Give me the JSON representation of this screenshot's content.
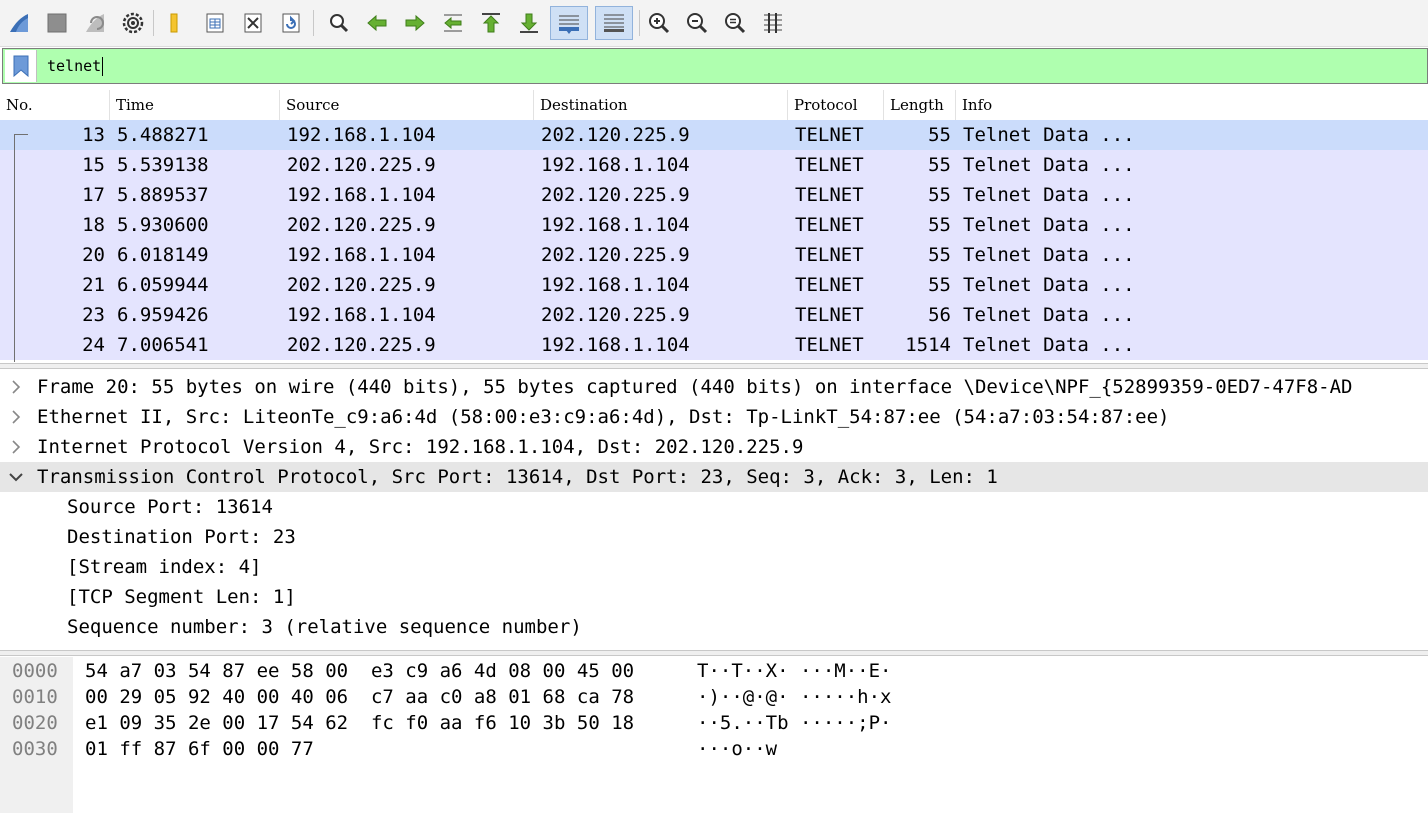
{
  "toolbar": {
    "buttons": [
      {
        "icon": "shark-fin-start-icon"
      },
      {
        "icon": "stop-square-icon"
      },
      {
        "icon": "restart-capture-icon"
      },
      {
        "icon": "capture-options-gear-icon"
      },
      {
        "icon": "open-folder-icon"
      },
      {
        "icon": "save-file-icon"
      },
      {
        "icon": "close-file-icon"
      },
      {
        "icon": "reload-file-icon"
      },
      {
        "icon": "find-packet-icon"
      },
      {
        "icon": "go-back-arrow-icon"
      },
      {
        "icon": "go-forward-arrow-icon"
      },
      {
        "icon": "go-to-packet-icon"
      },
      {
        "icon": "go-first-packet-icon"
      },
      {
        "icon": "go-last-packet-icon"
      },
      {
        "icon": "auto-scroll-icon",
        "active": true
      },
      {
        "icon": "colorize-icon",
        "active": true
      },
      {
        "icon": "zoom-in-icon"
      },
      {
        "icon": "zoom-out-icon"
      },
      {
        "icon": "normal-size-icon"
      },
      {
        "icon": "resize-columns-icon"
      }
    ]
  },
  "filter": {
    "value": "telnet",
    "background": "#afffaf"
  },
  "packet_list": {
    "columns": [
      "No.",
      "Time",
      "Source",
      "Destination",
      "Protocol",
      "Length",
      "Info"
    ],
    "rows": [
      {
        "no": "13",
        "time": "5.488271",
        "src": "192.168.1.104",
        "dst": "202.120.225.9",
        "proto": "TELNET",
        "len": "55",
        "info": "Telnet Data ...",
        "selected": true
      },
      {
        "no": "15",
        "time": "5.539138",
        "src": "202.120.225.9",
        "dst": "192.168.1.104",
        "proto": "TELNET",
        "len": "55",
        "info": "Telnet Data ..."
      },
      {
        "no": "17",
        "time": "5.889537",
        "src": "192.168.1.104",
        "dst": "202.120.225.9",
        "proto": "TELNET",
        "len": "55",
        "info": "Telnet Data ..."
      },
      {
        "no": "18",
        "time": "5.930600",
        "src": "202.120.225.9",
        "dst": "192.168.1.104",
        "proto": "TELNET",
        "len": "55",
        "info": "Telnet Data ..."
      },
      {
        "no": "20",
        "time": "6.018149",
        "src": "192.168.1.104",
        "dst": "202.120.225.9",
        "proto": "TELNET",
        "len": "55",
        "info": "Telnet Data ..."
      },
      {
        "no": "21",
        "time": "6.059944",
        "src": "202.120.225.9",
        "dst": "192.168.1.104",
        "proto": "TELNET",
        "len": "55",
        "info": "Telnet Data ..."
      },
      {
        "no": "23",
        "time": "6.959426",
        "src": "192.168.1.104",
        "dst": "202.120.225.9",
        "proto": "TELNET",
        "len": "56",
        "info": "Telnet Data ..."
      },
      {
        "no": "24",
        "time": "7.006541",
        "src": "202.120.225.9",
        "dst": "192.168.1.104",
        "proto": "TELNET",
        "len": "1514",
        "info": "Telnet Data ..."
      }
    ]
  },
  "details": {
    "items": [
      {
        "text": "Frame 20: 55 bytes on wire (440 bits), 55 bytes captured (440 bits) on interface \\Device\\NPF_{52899359-0ED7-47F8-AD",
        "expanded": false,
        "level": 0
      },
      {
        "text": "Ethernet II, Src: LiteonTe_c9:a6:4d (58:00:e3:c9:a6:4d), Dst: Tp-LinkT_54:87:ee (54:a7:03:54:87:ee)",
        "expanded": false,
        "level": 0
      },
      {
        "text": "Internet Protocol Version 4, Src: 192.168.1.104, Dst: 202.120.225.9",
        "expanded": false,
        "level": 0
      },
      {
        "text": "Transmission Control Protocol, Src Port: 13614, Dst Port: 23, Seq: 3, Ack: 3, Len: 1",
        "expanded": true,
        "level": 0
      },
      {
        "text": "Source Port: 13614",
        "level": 1
      },
      {
        "text": "Destination Port: 23",
        "level": 1
      },
      {
        "text": "[Stream index: 4]",
        "level": 1
      },
      {
        "text": "[TCP Segment Len: 1]",
        "level": 1
      },
      {
        "text": "Sequence number: 3    (relative sequence number)",
        "level": 1
      }
    ]
  },
  "bytes": {
    "rows": [
      {
        "offset": "0000",
        "hex": "54 a7 03 54 87 ee 58 00  e3 c9 a6 4d 08 00 45 00",
        "ascii": "T··T··X· ···M··E·"
      },
      {
        "offset": "0010",
        "hex": "00 29 05 92 40 00 40 06  c7 aa c0 a8 01 68 ca 78",
        "ascii": "·)··@·@· ·····h·x"
      },
      {
        "offset": "0020",
        "hex": "e1 09 35 2e 00 17 54 62  fc f0 aa f6 10 3b 50 18",
        "ascii": "··5.··Tb ·····;P·"
      },
      {
        "offset": "0030",
        "hex": "01 ff 87 6f 00 00 77",
        "ascii": "···o··w"
      }
    ]
  }
}
